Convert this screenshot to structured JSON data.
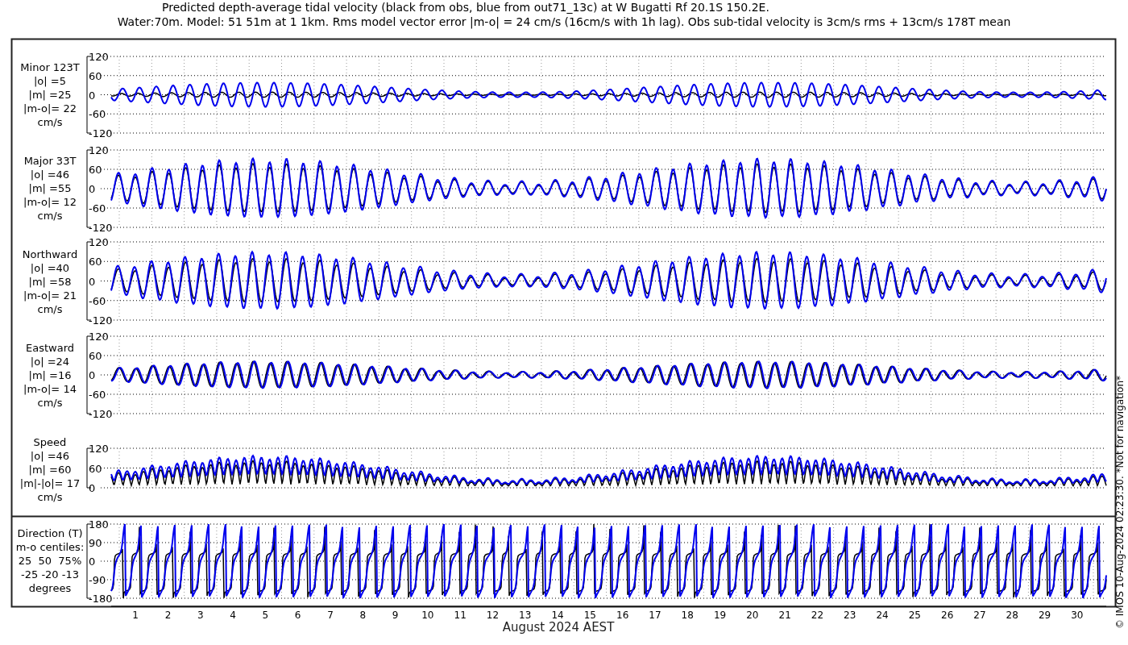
{
  "title": [
    "Predicted depth-average tidal velocity (black from obs, blue from out71_13c) at W Bugatti Rf 20.1S 150.2E.",
    "Water:70m. Model: 51 51m at 1 1km. Rms model vector error |m-o| = 24 cm/s (16cm/s with 1h lag). Obs sub-tidal velocity is 3cm/s rms + 13cm/s 178T mean"
  ],
  "panels": [
    {
      "kind": "minor",
      "label": [
        "Minor 123T",
        "|o| =5",
        "|m| =25",
        "|m-o|= 22",
        "cm/s"
      ],
      "yticks": [
        "120",
        "60",
        "0",
        "-60",
        "-120"
      ]
    },
    {
      "kind": "major",
      "label": [
        "Major 33T",
        "|o| =46",
        "|m| =55",
        "|m-o|= 12",
        "cm/s"
      ],
      "yticks": [
        "120",
        "60",
        "0",
        "-60",
        "-120"
      ]
    },
    {
      "kind": "north",
      "label": [
        "Northward",
        "|o| =40",
        "|m| =58",
        "|m-o|= 21",
        "cm/s"
      ],
      "yticks": [
        "120",
        "60",
        "0",
        "-60",
        "-120"
      ]
    },
    {
      "kind": "east",
      "label": [
        "Eastward",
        "|o| =24",
        "|m| =16",
        "|m-o|= 14",
        "cm/s"
      ],
      "yticks": [
        "120",
        "60",
        "0",
        "-60",
        "-120"
      ]
    },
    {
      "kind": "speed",
      "label": [
        "Speed",
        "|o| =46",
        "|m| =60",
        "|m|-|o|= 17",
        "cm/s"
      ],
      "yticks": [
        "120",
        "60",
        "0"
      ]
    },
    {
      "kind": "direction",
      "label": [
        "Direction (T)",
        "m-o centiles:",
        "25  50  75%",
        "-25 -20 -13",
        "degrees"
      ],
      "yticks": [
        "180",
        "90",
        "0",
        "-90",
        "-180"
      ]
    }
  ],
  "x_axis": {
    "days": [
      "1",
      "2",
      "3",
      "4",
      "5",
      "6",
      "7",
      "8",
      "9",
      "10",
      "11",
      "12",
      "13",
      "14",
      "15",
      "16",
      "17",
      "18",
      "19",
      "20",
      "21",
      "22",
      "23",
      "24",
      "25",
      "26",
      "27",
      "28",
      "29",
      "30"
    ],
    "title": "August 2024 AEST"
  },
  "credit": "© IMOS 10-Aug-2024 02:23:30. *Not for navigation*"
}
